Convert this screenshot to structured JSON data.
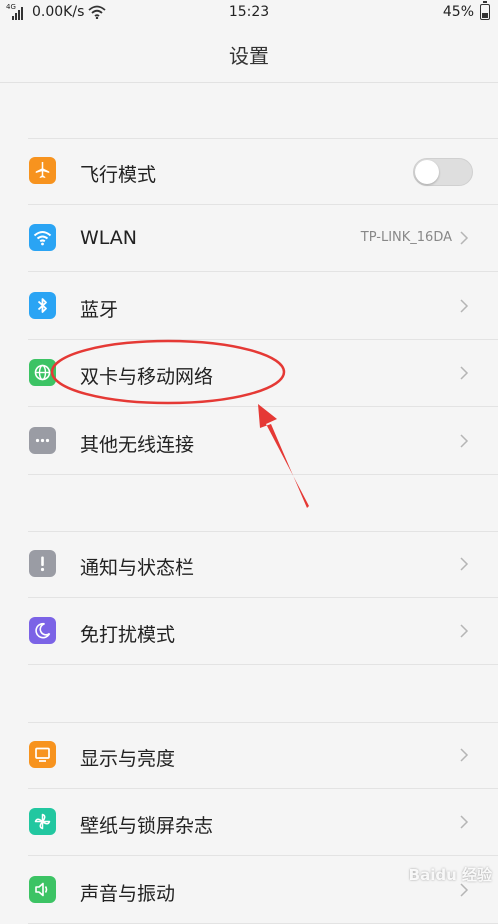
{
  "status_bar": {
    "network_badge": "4G",
    "speed": "0.00K/s",
    "time": "15:23",
    "battery": "45%",
    "battery_level": 0.45
  },
  "header": {
    "title": "设置"
  },
  "groups": [
    {
      "items": [
        {
          "id": "airplane",
          "label": "飞行模式",
          "icon": "airplane-icon",
          "icon_color": "#f7931e",
          "control": "toggle",
          "toggle_on": false
        },
        {
          "id": "wlan",
          "label": "WLAN",
          "icon": "wifi-icon",
          "icon_color": "#2aa4f4",
          "value": "TP-LINK_16DA",
          "control": "chevron"
        },
        {
          "id": "bluetooth",
          "label": "蓝牙",
          "icon": "bluetooth-icon",
          "icon_color": "#2aa4f4",
          "control": "chevron"
        },
        {
          "id": "dual-sim",
          "label": "双卡与移动网络",
          "icon": "globe-icon",
          "icon_color": "#3cc364",
          "control": "chevron"
        },
        {
          "id": "other-wireless",
          "label": "其他无线连接",
          "icon": "more-icon",
          "icon_color": "#9a9ca4",
          "control": "chevron"
        }
      ]
    },
    {
      "items": [
        {
          "id": "notifications",
          "label": "通知与状态栏",
          "icon": "exclamation-icon",
          "icon_color": "#9a9ca4",
          "control": "chevron"
        },
        {
          "id": "do-not-disturb",
          "label": "免打扰模式",
          "icon": "moon-icon",
          "icon_color": "#7b63e6",
          "control": "chevron"
        }
      ]
    },
    {
      "items": [
        {
          "id": "display",
          "label": "显示与亮度",
          "icon": "monitor-icon",
          "icon_color": "#f7931e",
          "control": "chevron"
        },
        {
          "id": "wallpaper",
          "label": "壁纸与锁屏杂志",
          "icon": "pinwheel-icon",
          "icon_color": "#22c7a0",
          "control": "chevron"
        },
        {
          "id": "sound",
          "label": "声音与振动",
          "icon": "speaker-icon",
          "icon_color": "#3cc364",
          "control": "chevron"
        }
      ]
    }
  ],
  "annotation_color": "#e53935",
  "watermark": "Baidu 经验"
}
